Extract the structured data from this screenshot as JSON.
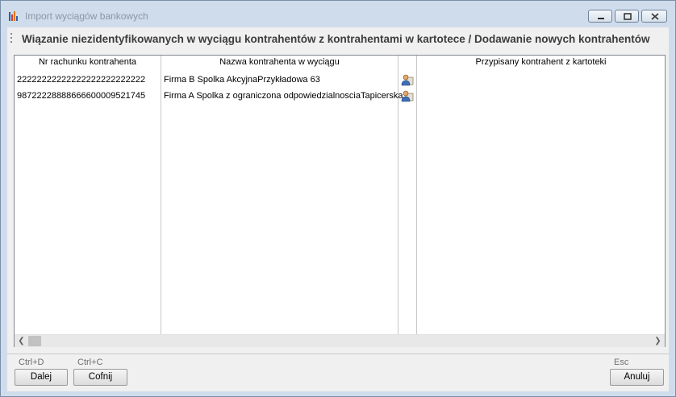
{
  "window": {
    "title": "Import wyciągów bankowych"
  },
  "header": {
    "title": "Wiązanie niezidentyfikowanych w wyciągu kontrahentów z kontrahentami w kartotece / Dodawanie nowych kontrahentów"
  },
  "table": {
    "columns": [
      "Nr rachunku kontrahenta",
      "Nazwa kontrahenta w wyciągu",
      "",
      "Przypisany kontrahent z kartoteki"
    ],
    "rows": [
      {
        "account": "22222222222222222222222222",
        "name": "Firma B Spolka AkcyjnaPrzykładowa 63",
        "assigned": ""
      },
      {
        "account": "98722228888666600009521745",
        "name": "Firma A Spolka z ograniczona odpowiedzialnosciaTapicerska",
        "assigned": ""
      }
    ]
  },
  "buttons": {
    "next": {
      "label": "Dalej",
      "shortcut": "Ctrl+D"
    },
    "back": {
      "label": "Cofnij",
      "shortcut": "Ctrl+C"
    },
    "cancel": {
      "label": "Anuluj",
      "shortcut": "Esc"
    }
  },
  "icons": [
    "app-chart-icon",
    "minimize-icon",
    "maximize-icon",
    "close-icon",
    "person-card-icon",
    "scroll-left-icon",
    "scroll-right-icon"
  ]
}
